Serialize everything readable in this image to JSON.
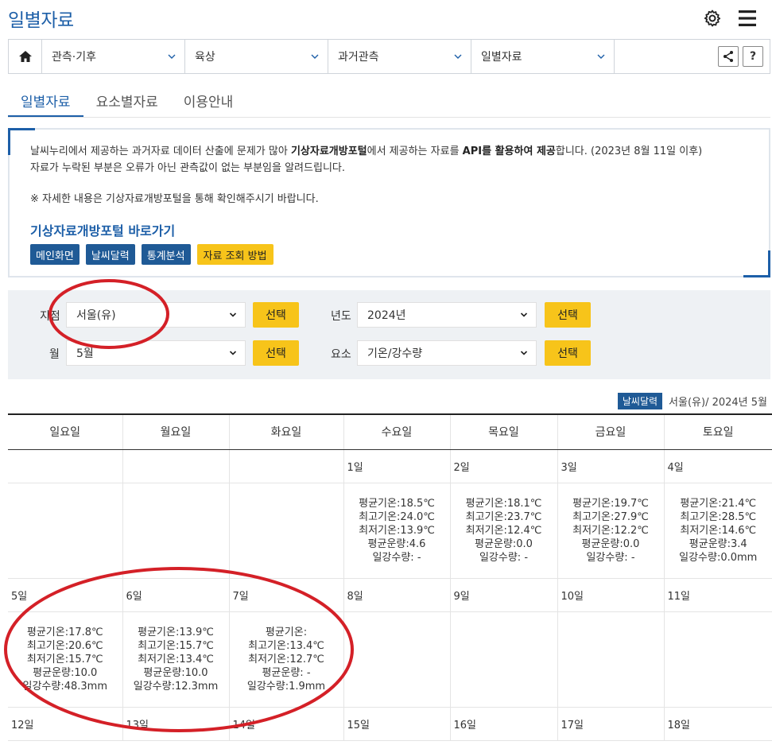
{
  "page": {
    "title": "일별자료"
  },
  "nav": {
    "items": [
      {
        "label": "관측·기후"
      },
      {
        "label": "육상"
      },
      {
        "label": "과거관측"
      },
      {
        "label": "일별자료"
      }
    ],
    "help_label": "?"
  },
  "tabs": [
    {
      "label": "일별자료",
      "active": true
    },
    {
      "label": "요소별자료",
      "active": false
    },
    {
      "label": "이용안내",
      "active": false
    }
  ],
  "notice": {
    "line1_a": "날씨누리에서 제공하는 과거자료 데이터 산출에 문제가 많아 ",
    "line1_b": "기상자료개방포털",
    "line1_c": "에서 제공하는 자료를 ",
    "line1_d": "API를 활용하여 제공",
    "line1_e": "합니다. (2023년 8월 11일 이후)",
    "line2": "자료가 누락된 부분은 오류가 아닌 관측값이 없는 부분임을 알려드립니다.",
    "line3": "※ 자세한 내용은 기상자료개방포털을 통해 확인해주시기 바랍니다.",
    "portal_title": "기상자료개방포털 바로가기",
    "buttons": [
      "메인화면",
      "날씨달력",
      "통계분석"
    ],
    "howto_button": "자료 조회 방법"
  },
  "search": {
    "station_label": "지점",
    "station_value": "서울(유)",
    "year_label": "년도",
    "year_value": "2024년",
    "month_label": "월",
    "month_value": "5월",
    "element_label": "요소",
    "element_value": "기온/강수량",
    "select_button": "선택"
  },
  "calendar": {
    "badge": "날씨달력",
    "caption": "서울(유)/ 2024년 5월",
    "weekdays": [
      "일요일",
      "월요일",
      "화요일",
      "수요일",
      "목요일",
      "금요일",
      "토요일"
    ],
    "week1": {
      "days": [
        "",
        "",
        "",
        "1일",
        "2일",
        "3일",
        "4일"
      ],
      "data": [
        [],
        [],
        [],
        [
          "평균기온:18.5℃",
          "최고기온:24.0℃",
          "최저기온:13.9℃",
          "평균운량:4.6",
          "일강수량: -"
        ],
        [
          "평균기온:18.1℃",
          "최고기온:23.7℃",
          "최저기온:12.4℃",
          "평균운량:0.0",
          "일강수량: -"
        ],
        [
          "평균기온:19.7℃",
          "최고기온:27.9℃",
          "최저기온:12.2℃",
          "평균운량:0.0",
          "일강수량: -"
        ],
        [
          "평균기온:21.4℃",
          "최고기온:28.5℃",
          "최저기온:14.6℃",
          "평균운량:3.4",
          "일강수량:0.0mm"
        ]
      ]
    },
    "week2": {
      "days": [
        "5일",
        "6일",
        "7일",
        "8일",
        "9일",
        "10일",
        "11일"
      ],
      "data": [
        [
          "평균기온:17.8℃",
          "최고기온:20.6℃",
          "최저기온:15.7℃",
          "평균운량:10.0",
          "일강수량:48.3mm"
        ],
        [
          "평균기온:13.9℃",
          "최고기온:15.7℃",
          "최저기온:13.4℃",
          "평균운량:10.0",
          "일강수량:12.3mm"
        ],
        [
          "평균기온:",
          "최고기온:13.4℃",
          "최저기온:12.7℃",
          "평균운량: -",
          "일강수량:1.9mm"
        ],
        [],
        [],
        [],
        []
      ]
    },
    "week3": {
      "days": [
        "12일",
        "13일",
        "14일",
        "15일",
        "16일",
        "17일",
        "18일"
      ]
    }
  },
  "colors": {
    "brand_blue": "#1d5fa8",
    "button_blue": "#1f5a96",
    "button_yellow": "#f7c41a",
    "annotation_red": "#d42027"
  }
}
